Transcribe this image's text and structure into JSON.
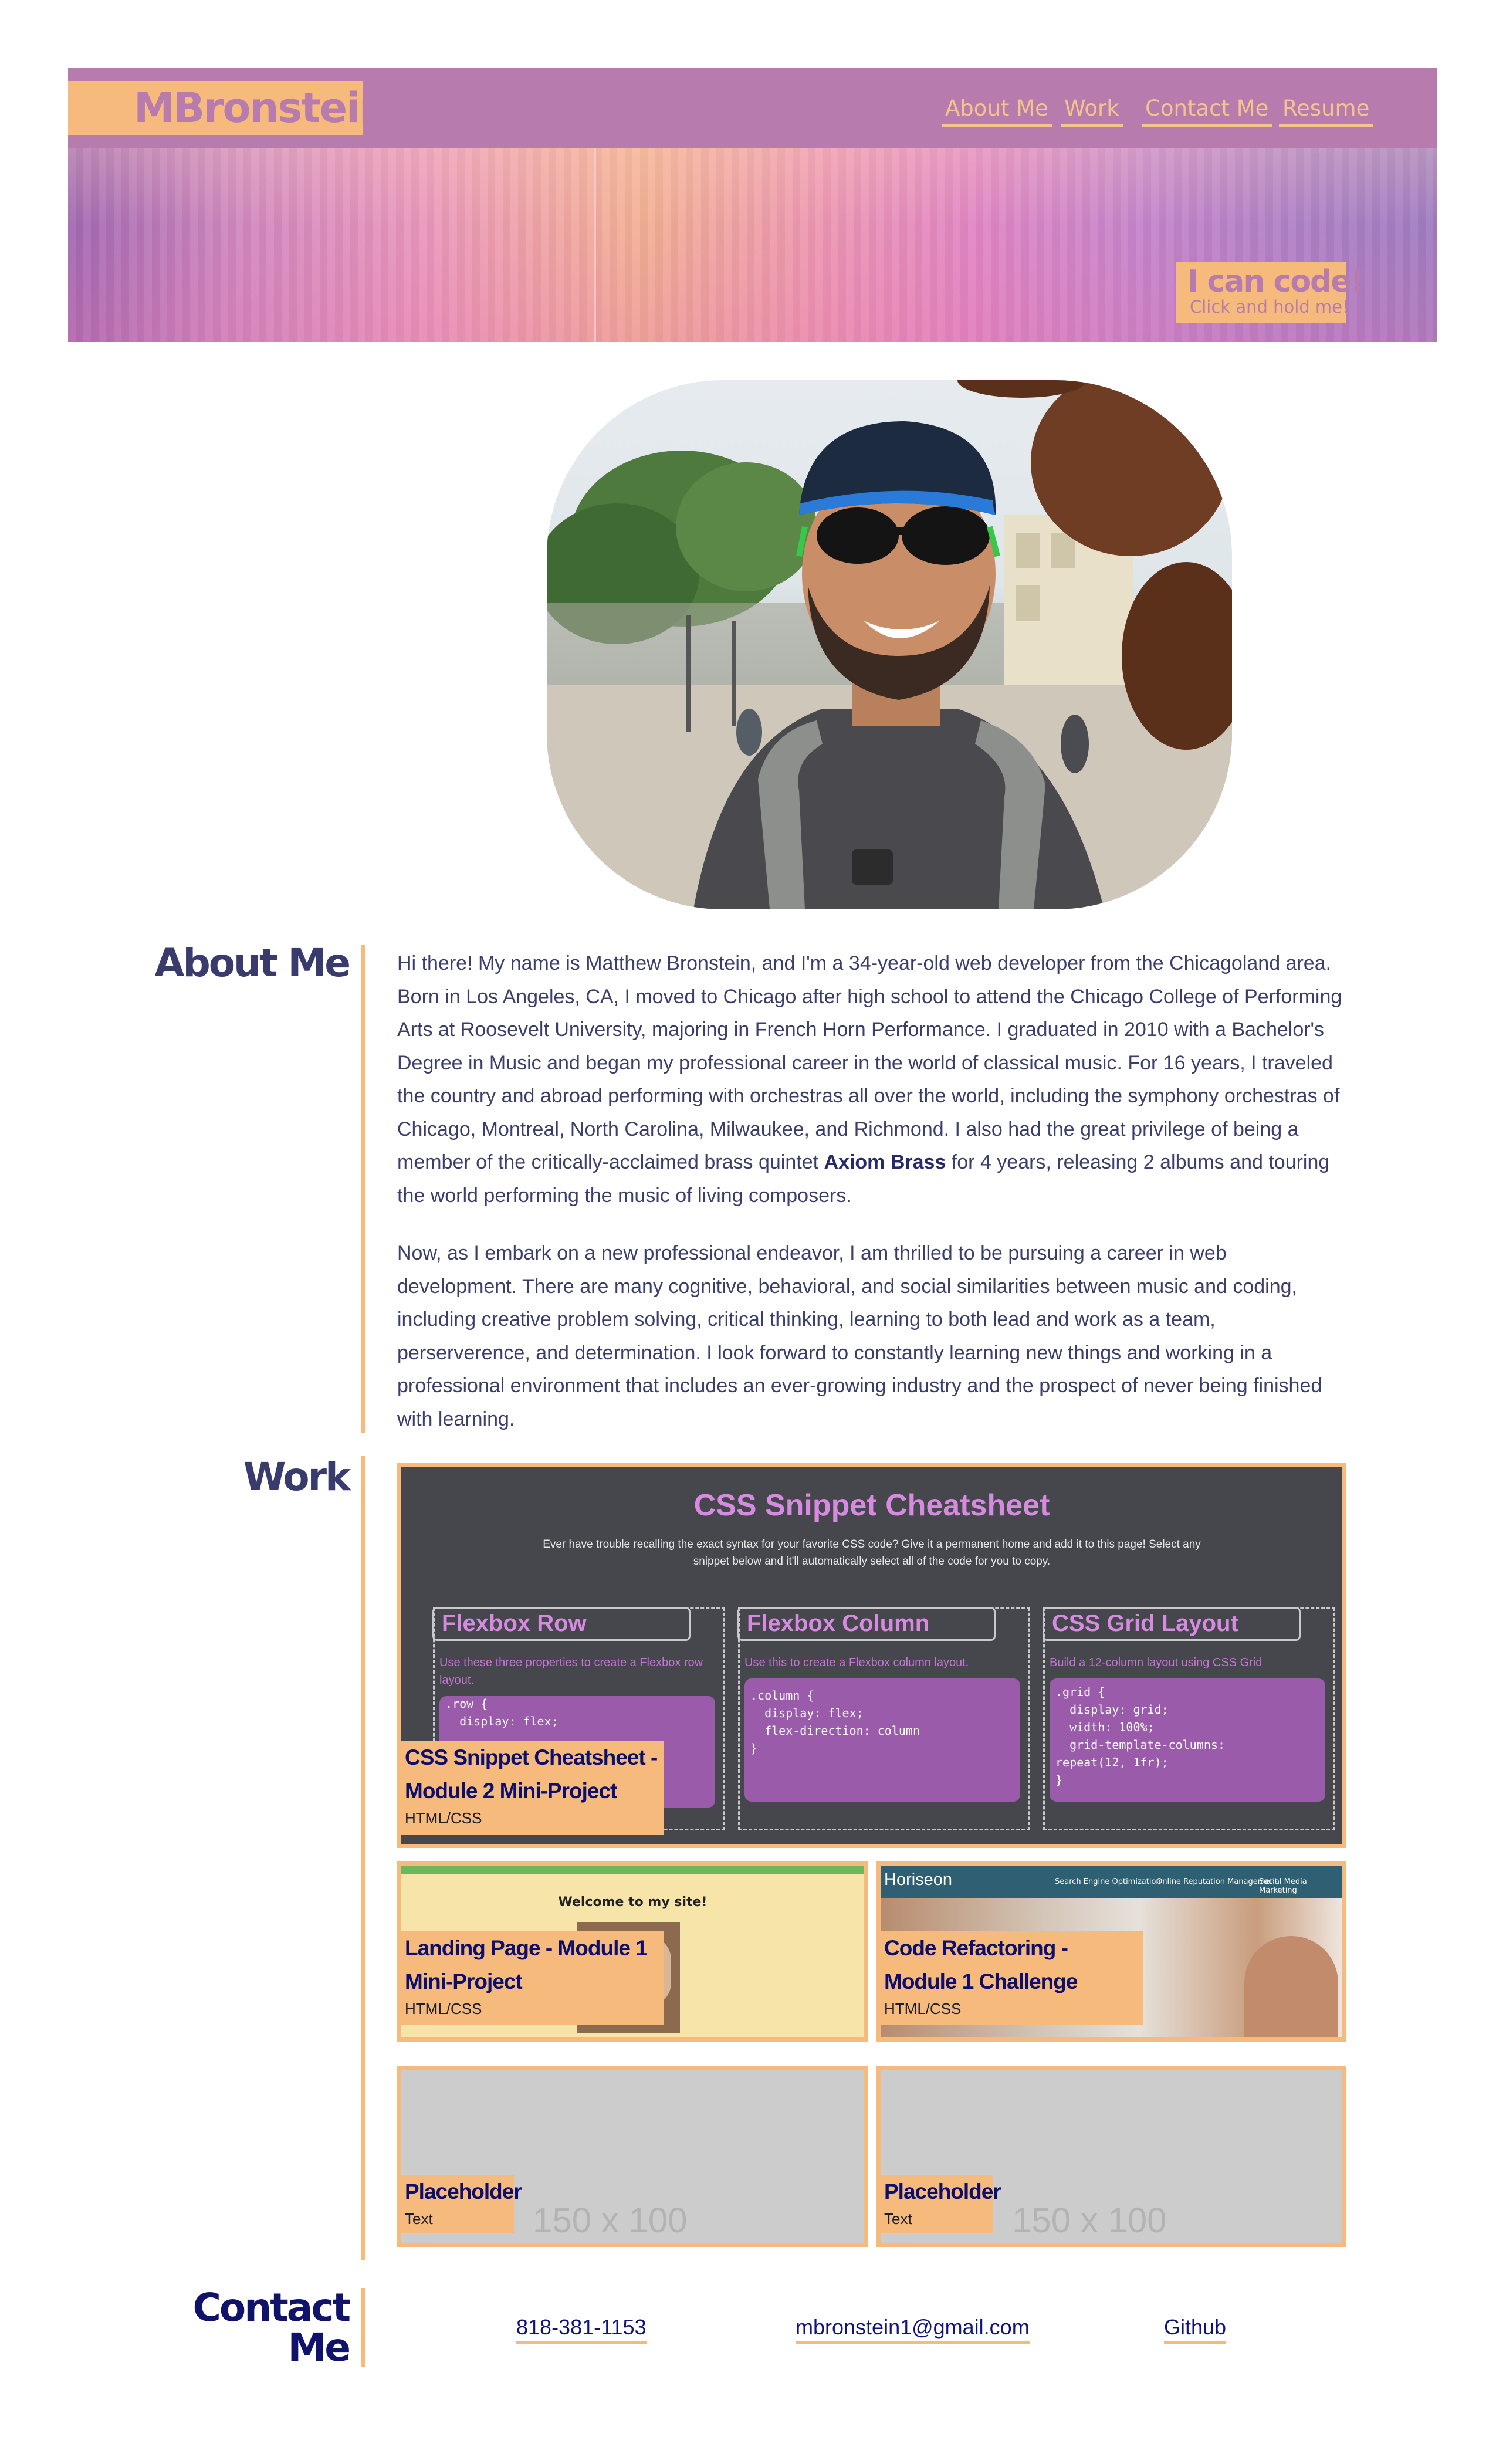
{
  "header": {
    "logo": "MBronstein",
    "nav": [
      "About Me",
      "Work",
      "Contact Me",
      "Resume"
    ]
  },
  "hero": {
    "title": "I can code!",
    "subtitle": "Click and hold me!"
  },
  "profile": {
    "alt": "Profile photo of Matthew Bronstein"
  },
  "about": {
    "heading": "About Me",
    "p1_before": "Hi there! My name is Matthew Bronstein, and I'm a 34-year-old web developer from the Chicagoland area. Born in Los Angeles, CA, I moved to Chicago after high school to attend the Chicago College of Performing Arts at Roosevelt University, majoring in French Horn Performance. I graduated in 2010 with a Bachelor's Degree in Music and began my professional career in the world of classical music. For 16 years, I traveled the country and abroad performing with orchestras all over the world, including the symphony orchestras of Chicago, Montreal, North Carolina, Milwaukee, and Richmond. I also had the great privilege of being a member of the critically-acclaimed brass quintet ",
    "p1_link": "Axiom Brass",
    "p1_after": " for 4 years, releasing 2 albums and touring the world performing the music of living composers.",
    "p2": "Now, as I embark on a new professional endeavor, I am thrilled to be pursuing a career in web development. There are many cognitive, behavioral, and social similarities between music and coding, including creative problem solving, critical thinking, learning to both lead and work as a team, perserverence, and determination. I look forward to constantly learning new things and working in a professional environment that includes an ever-growing industry and the prospect of never being finished with learning."
  },
  "work": {
    "heading": "Work",
    "featured": {
      "title": "CSS Snippet Cheatsheet - Module 2 Mini-Project",
      "tech": "HTML/CSS",
      "screenshot": {
        "heading": "CSS Snippet Cheatsheet",
        "intro": "Ever have trouble recalling the exact syntax for your favorite CSS code? Give it a permanent home and add it to this page! Select any snippet below and it'll automatically select all of the code for you to copy.",
        "cards": [
          {
            "title": "Flexbox Row",
            "desc": "Use these three properties to create a Flexbox row layout.",
            "code": ".row {\n  display: flex;"
          },
          {
            "title": "Flexbox Column",
            "desc": "Use this to create a Flexbox column layout.",
            "code": ".column {\n  display: flex;\n  flex-direction: column\n}"
          },
          {
            "title": "CSS Grid Layout",
            "desc": "Build a 12-column layout using CSS Grid",
            "code": ".grid {\n  display: grid;\n  width: 100%;\n  grid-template-columns:\nrepeat(12, 1fr);\n}"
          }
        ]
      }
    },
    "projects": [
      {
        "title": "Landing Page - Module 1 Mini-Project",
        "tech": "HTML/CSS",
        "shot_heading": "Welcome to my site!"
      },
      {
        "title": "Code Refactoring - Module 1 Challenge",
        "tech": "HTML/CSS",
        "shot_brand": "Horiseon",
        "shot_nav": [
          "Search Engine Optimization",
          "Online Reputation Management",
          "Social Media Marketing"
        ]
      },
      {
        "title": "Placeholder",
        "tech": "Text",
        "placeholder": "150 x 100"
      },
      {
        "title": "Placeholder",
        "tech": "Text",
        "placeholder": "150 x 100"
      }
    ]
  },
  "contact": {
    "heading_line1": "Contact",
    "heading_line2": "Me",
    "phone": "818-381-1153",
    "email": "mbronstein1@gmail.com",
    "github": "Github"
  },
  "colors": {
    "header": "#b87bad",
    "accent": "#f6bb7c",
    "heading": "#383b6c",
    "link": "#0f137a"
  }
}
